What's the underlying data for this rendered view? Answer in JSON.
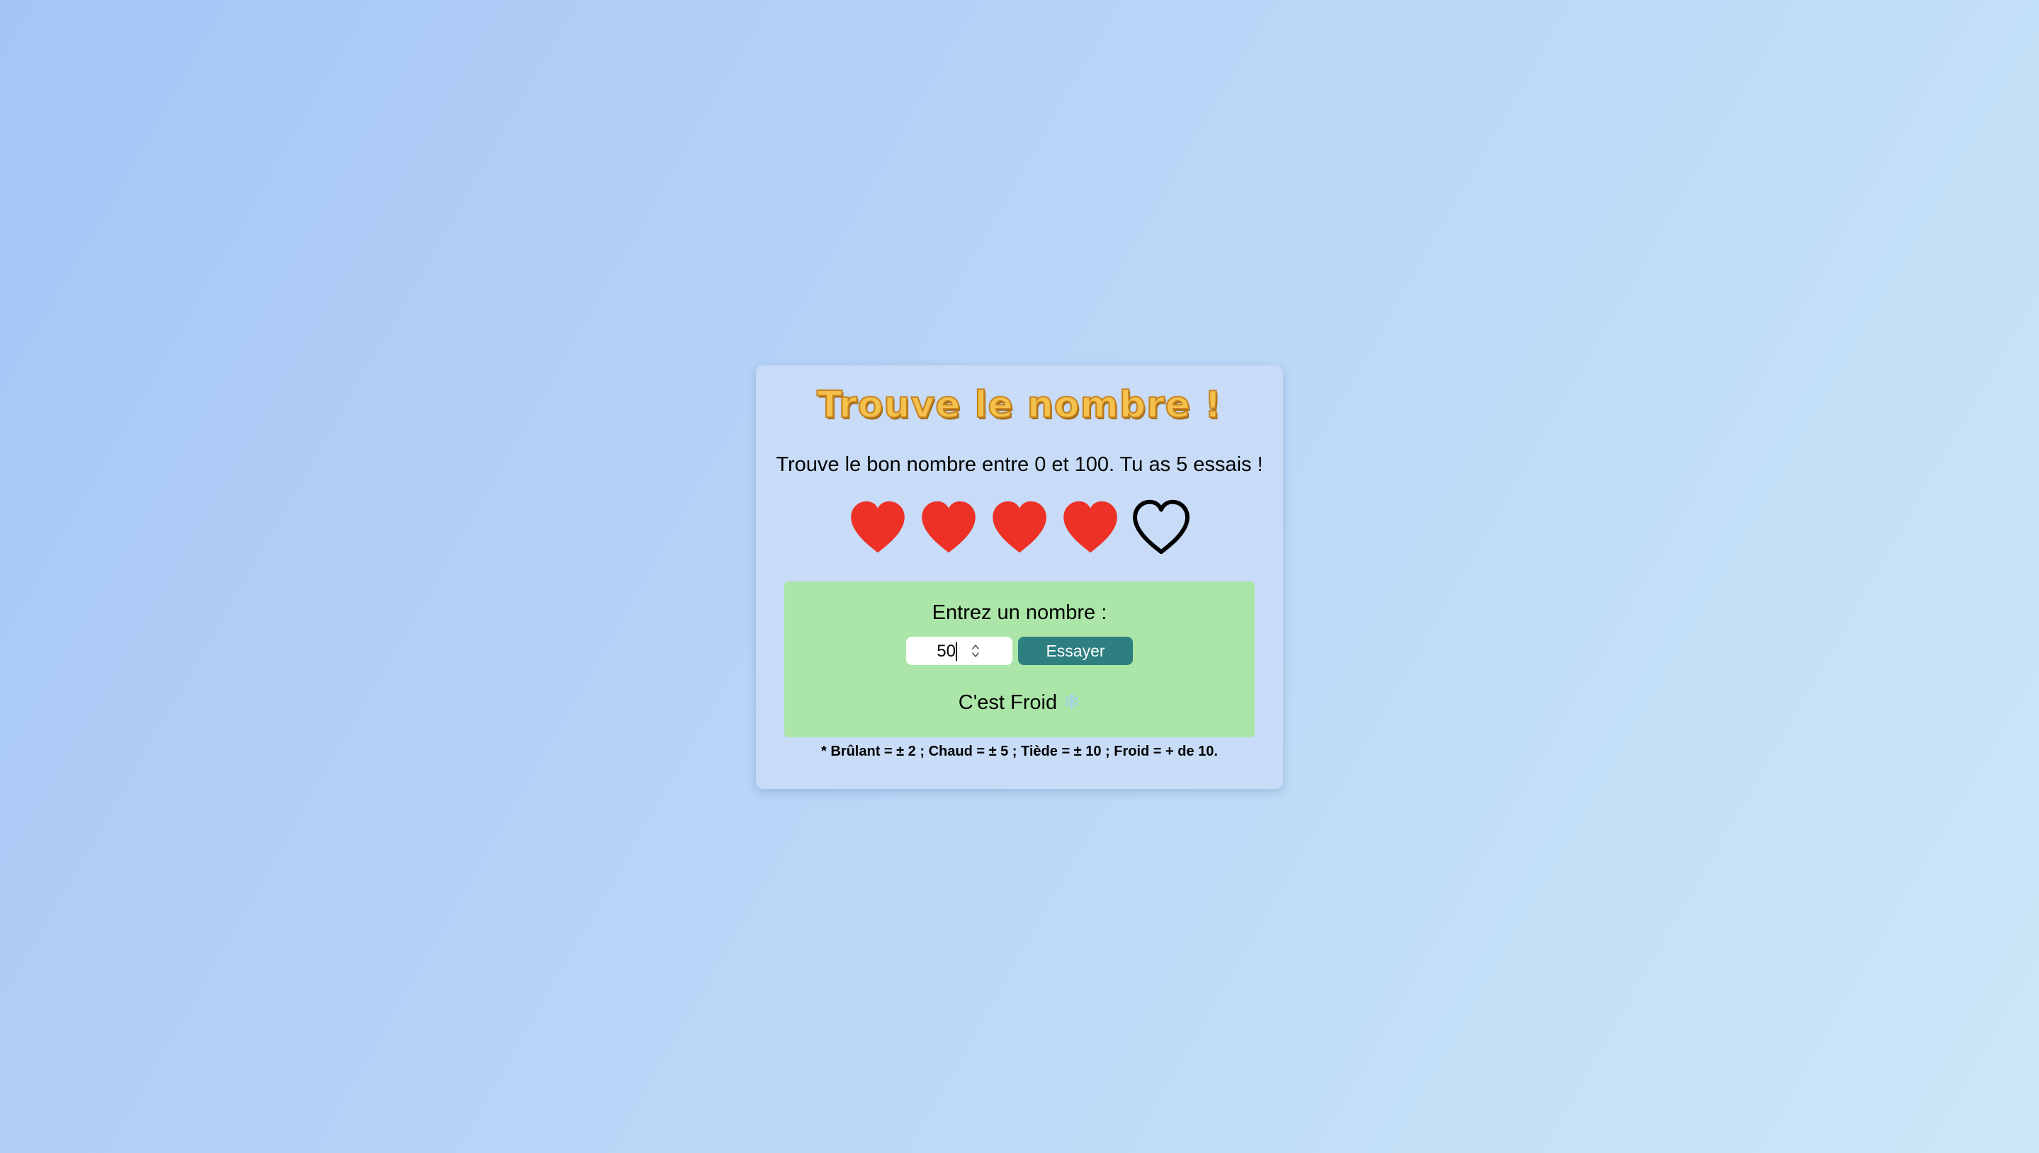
{
  "title": "Trouve le nombre !",
  "intro": "Trouve le bon nombre entre 0 et 100. Tu as 5 essais !",
  "lives": {
    "total": 5,
    "remaining": 4,
    "full_color": "#ee3126",
    "empty_color": "#000000"
  },
  "form": {
    "prompt": "Entrez un nombre :",
    "input_value": "50",
    "button_label": "Essayer"
  },
  "result": {
    "text": "C'est Froid",
    "icon": "snowflake-icon",
    "icon_glyph": "❄"
  },
  "legend": "* Brûlant = ± 2 ; Chaud = ± 5 ; Tiède = ± 10 ; Froid = + de 10.",
  "colors": {
    "title": "#f3c14c",
    "panel": "#abe6a8",
    "button": "#2d7f80"
  }
}
